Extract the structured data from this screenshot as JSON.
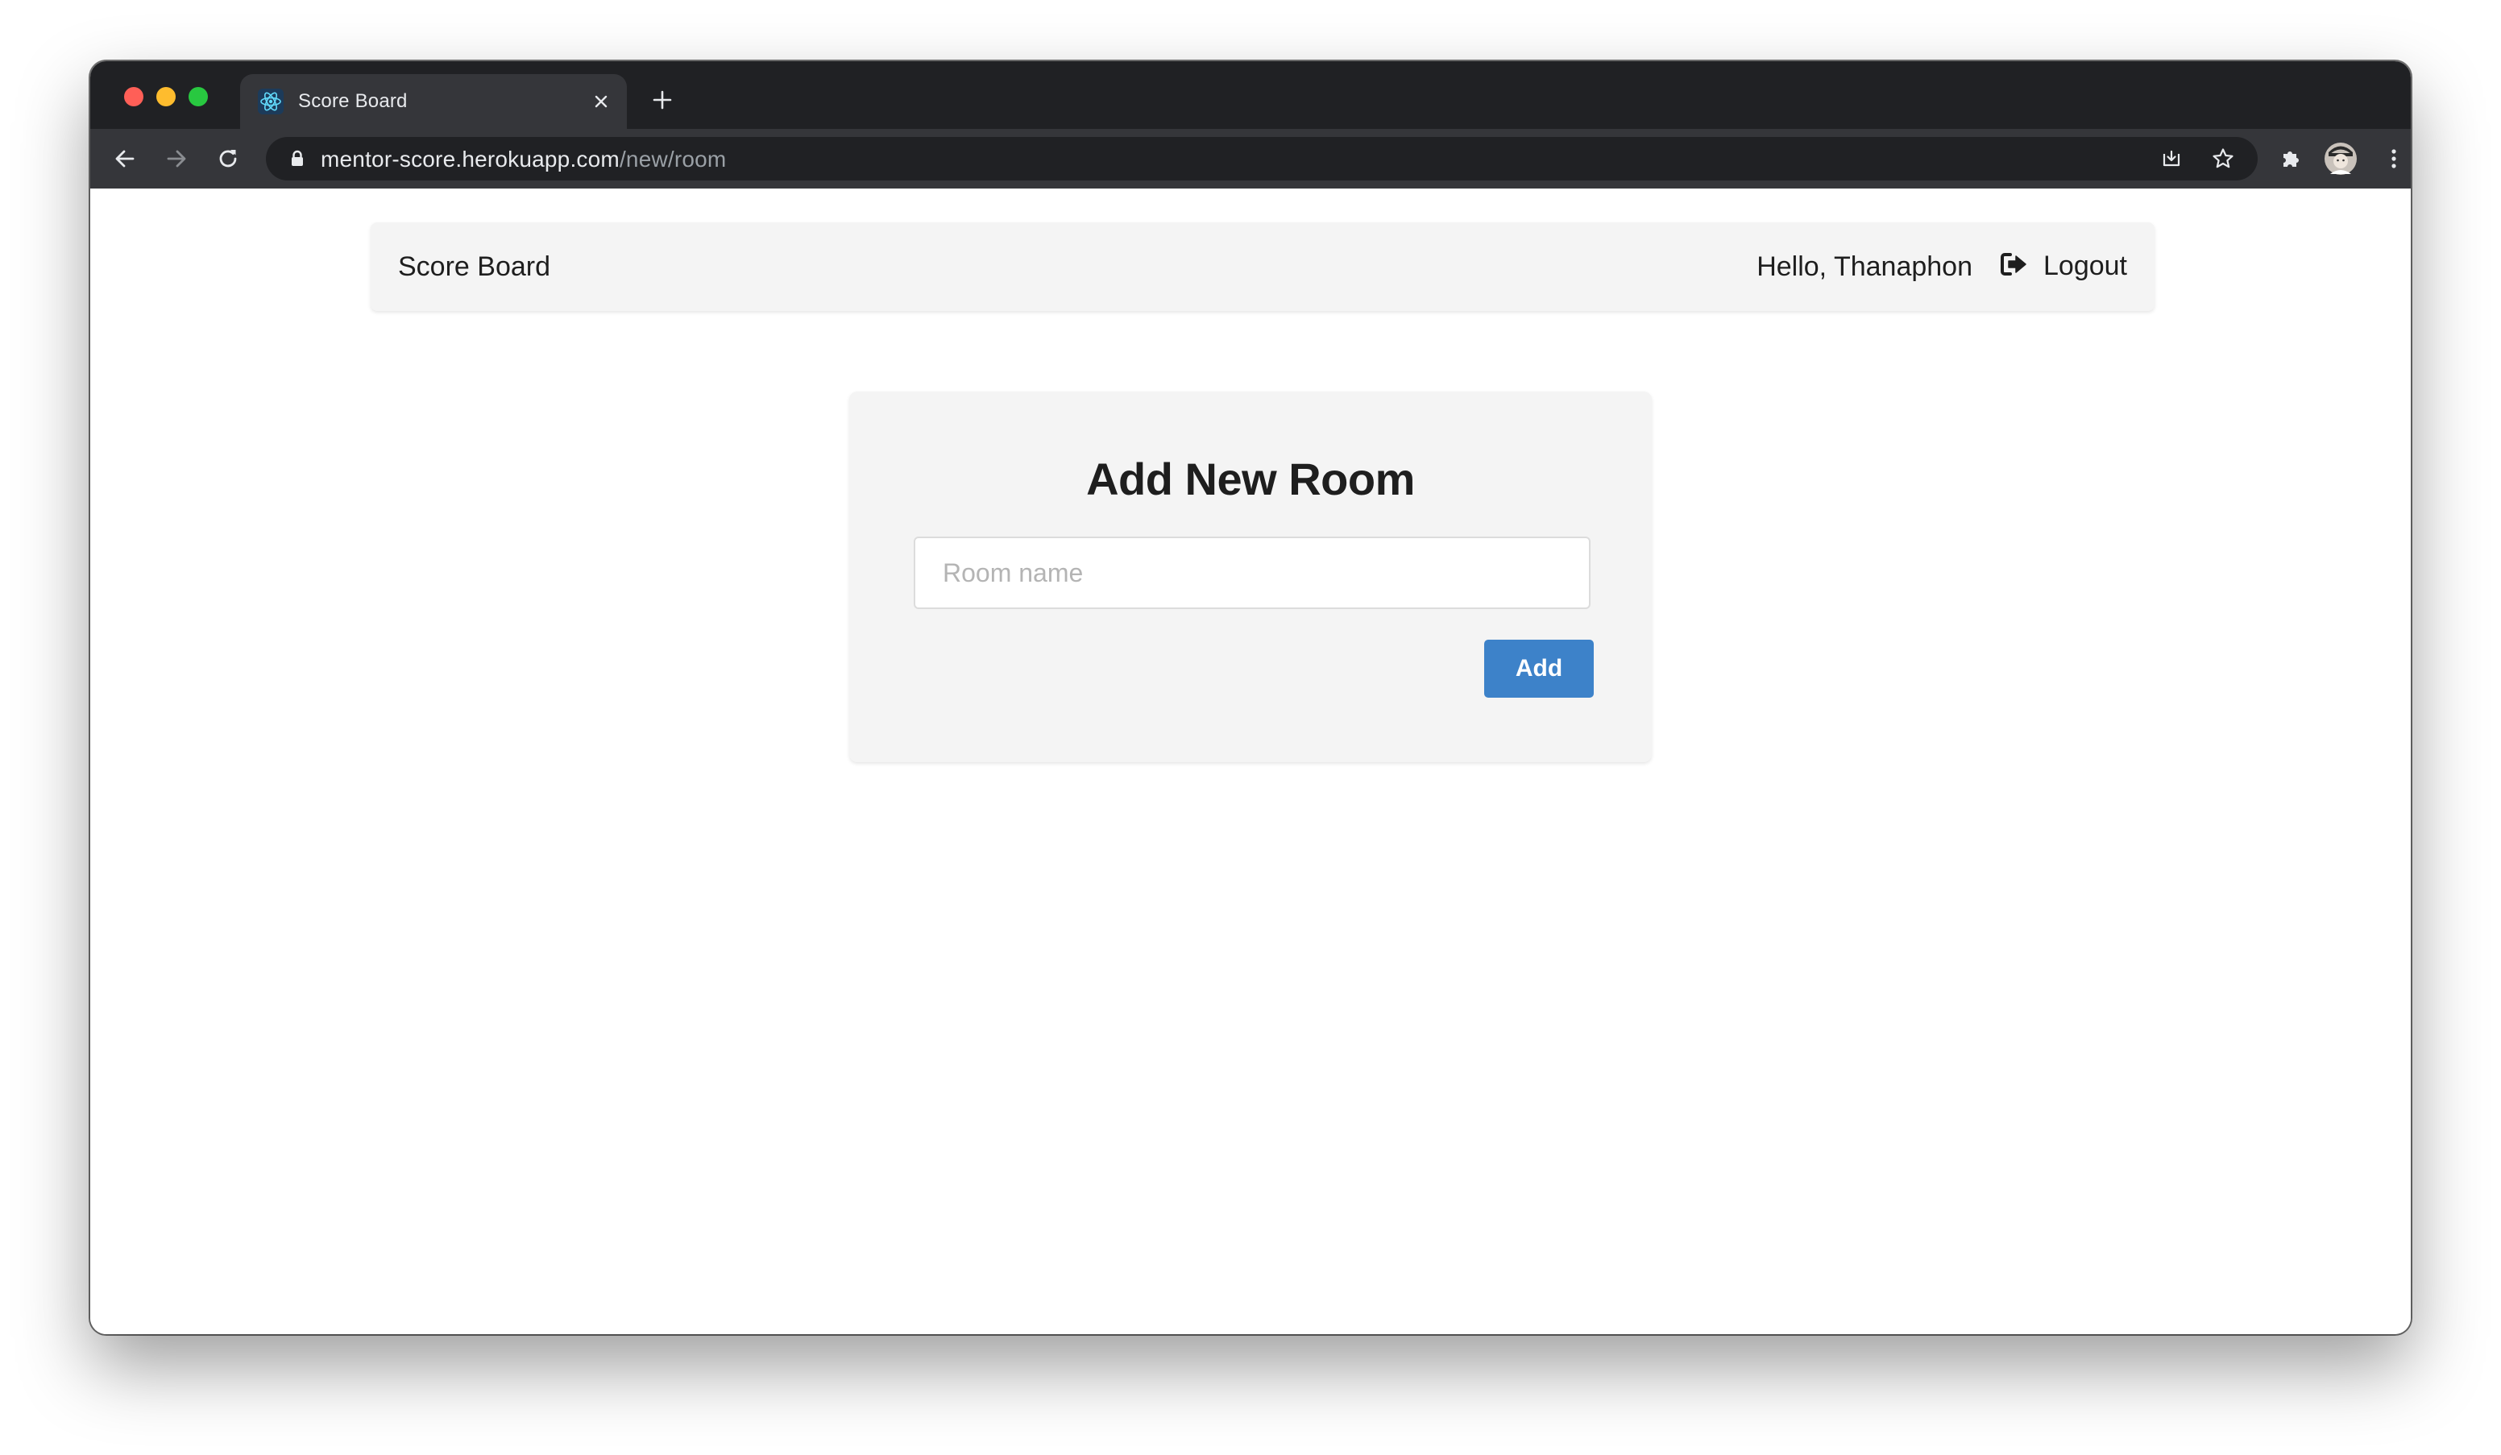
{
  "browser": {
    "tab": {
      "title": "Score Board",
      "favicon": "react-icon"
    },
    "url": {
      "host": "mentor-score.herokuapp.com",
      "path": "/new/room"
    },
    "toolbar_icons": [
      "back-icon",
      "forward-icon",
      "reload-icon",
      "lock-icon",
      "install-icon",
      "star-icon",
      "extensions-icon",
      "avatar",
      "menu-icon"
    ]
  },
  "navbar": {
    "brand": "Score Board",
    "greeting": "Hello, Thanaphon",
    "logout_label": "Logout"
  },
  "form": {
    "title": "Add New Room",
    "room_name_placeholder": "Room name",
    "room_name_value": "",
    "add_label": "Add"
  },
  "colors": {
    "primary_button": "#3d82c9",
    "navbar_bg": "#f4f4f4",
    "card_bg": "#f4f4f4",
    "browser_dark": "#202124"
  }
}
